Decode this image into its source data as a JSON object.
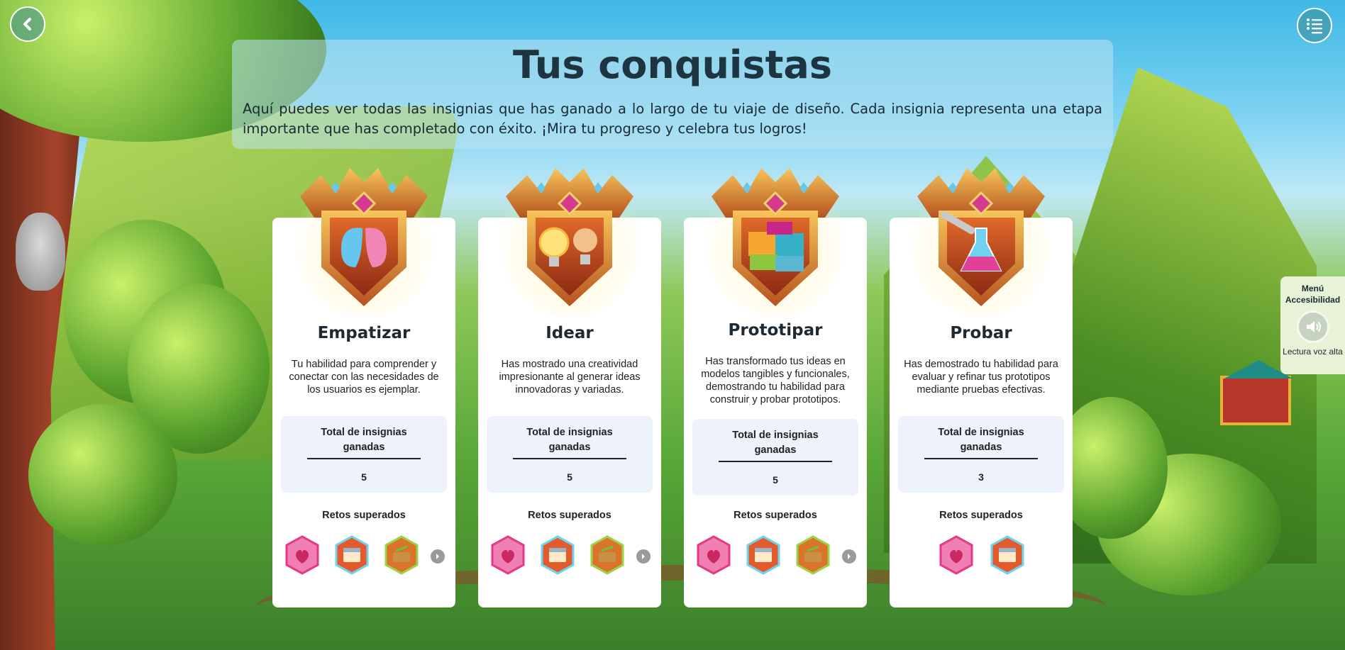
{
  "page": {
    "title": "Tus conquistas",
    "description": "Aquí puedes ver todas las insignias que has ganado a lo largo de tu viaje de diseño. Cada insignia representa una etapa importante que has completado con éxito. ¡Mira tu progreso y celebra tus logros!"
  },
  "nav": {
    "back_icon": "chevron-left-icon",
    "menu_icon": "list-menu-icon"
  },
  "cards": [
    {
      "title": "Empatizar",
      "description": "Tu habilidad para comprender y conectar con las necesidades de los usuarios es ejemplar.",
      "stats_label": "Total de insignias ganadas",
      "stats_value": "5",
      "retos_label": "Retos superados",
      "badge_icon": "hearts-badge-icon",
      "mini_badges": [
        "pink-heart-badge",
        "blue-chest-badge",
        "green-chest-badge"
      ],
      "has_more": true
    },
    {
      "title": "Idear",
      "description": "Has mostrado una creatividad impresionante al generar ideas innovadoras y variadas.",
      "stats_label": "Total de insignias ganadas",
      "stats_value": "5",
      "retos_label": "Retos superados",
      "badge_icon": "lightbulb-badge-icon",
      "mini_badges": [
        "pink-heart-badge",
        "blue-chest-badge",
        "green-chest-badge"
      ],
      "has_more": true
    },
    {
      "title": "Prototipar",
      "description": "Has transformado tus ideas en modelos tangibles y funcionales, demostrando tu habilidad para construir y probar prototipos.",
      "stats_label": "Total de insignias ganadas",
      "stats_value": "5",
      "retos_label": "Retos superados",
      "badge_icon": "puzzle-badge-icon",
      "mini_badges": [
        "pink-heart-badge",
        "blue-chest-badge",
        "green-chest-badge"
      ],
      "has_more": true
    },
    {
      "title": "Probar",
      "description": "Has demostrado tu habilidad para evaluar y refinar tus prototipos mediante pruebas efectivas.",
      "stats_label": "Total de insignias ganadas",
      "stats_value": "3",
      "retos_label": "Retos superados",
      "badge_icon": "flask-badge-icon",
      "mini_badges": [
        "pink-heart-badge",
        "blue-chest-badge"
      ],
      "has_more": false
    }
  ],
  "accessibility": {
    "title": "Menú Accesibilidad",
    "read_aloud": "Lectura voz alta",
    "speaker_icon": "speaker-icon"
  },
  "colors": {
    "title_text": "#1e3440",
    "card_bg": "#ffffff",
    "stats_bg": "#eef3fb",
    "badge_gold": "#e8a53a",
    "badge_gem": "#d63a8f",
    "accessibility_bg": "#e7f2d6"
  }
}
